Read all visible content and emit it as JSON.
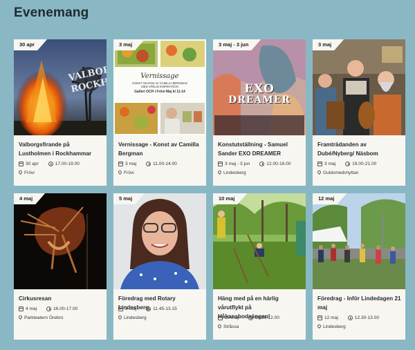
{
  "page": {
    "title": "Evenemang"
  },
  "events": [
    {
      "badge": "30 apr",
      "title": "Valborgsfirande på Lustholmen i Rockhammar",
      "date": "30 apr",
      "time": "17.00-19.00",
      "location": "Frövi",
      "image_text": [
        "VALBORG",
        "ROCKHAMM"
      ]
    },
    {
      "badge": "3 maj",
      "title": "Vernissage - Konst av Camilla Bergman",
      "date": "3 maj",
      "time": "11.00-14.00",
      "location": "Frövi",
      "image_text": [
        "Vernissage",
        "KONST SKAPAD AV CAMILLA BERGMAN",
        "MED VÅRLIG INSPIRATION",
        "Galleri OCH i Frövi Maj kl 11-14"
      ]
    },
    {
      "badge": "3 maj - 3 jun",
      "title": "Konstutställning - Samuel Sander EXO DREAMER",
      "date": "3 maj - 3 jun",
      "time": "12.00-18.00",
      "location": "Lindesberg",
      "image_text": [
        "EXO",
        "DREAMER"
      ]
    },
    {
      "badge": "3 maj",
      "title": "Framträdanden av Dubé/Nyberg/ Näsbom",
      "date": "3 maj",
      "time": "19.00-21.00",
      "location": "Guldsmedshyttan"
    },
    {
      "badge": "4 maj",
      "title": "Cirkusresan",
      "date": "4 maj",
      "time": "16.00-17.00",
      "location": "Parkteatern Örebro"
    },
    {
      "badge": "5 maj",
      "title": "Föredrag med Rotary Lindesberg",
      "date": "5 maj",
      "time": "11.45-13.15",
      "location": "Lindesberg"
    },
    {
      "badge": "10 maj",
      "title": "Häng med på en härlig vårutflykt på Håkansbodaängen!",
      "date": "10 maj",
      "time": "10.00-12.00",
      "location": "Stråssa"
    },
    {
      "badge": "12 maj",
      "title": "Föredrag - Inför Lindedagen 21 maj",
      "date": "12 maj",
      "time": "12.30-13.00",
      "location": "Lindesberg"
    }
  ]
}
